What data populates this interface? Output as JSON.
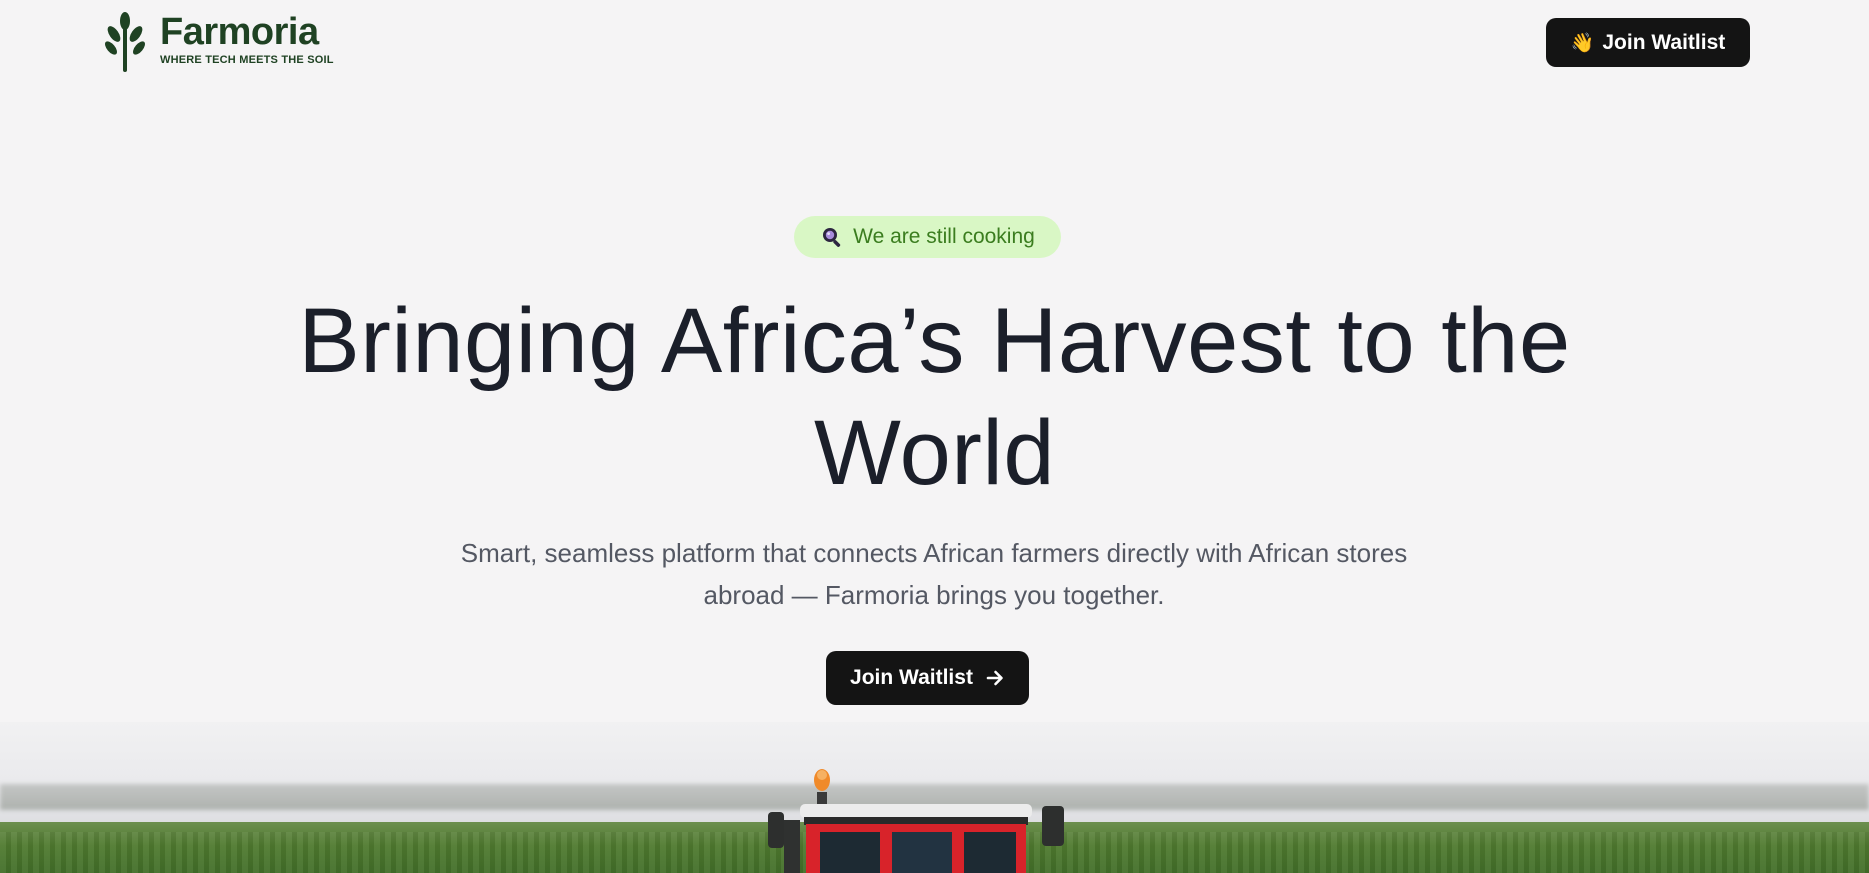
{
  "header": {
    "brand_name": "Farmoria",
    "tagline": "WHERE TECH MEETS THE SOIL",
    "cta_label": "Join Waitlist",
    "cta_icon": "waving-hand-icon"
  },
  "hero": {
    "badge_text": "We are still cooking",
    "badge_icon": "search-icon",
    "headline_line1": "Bringing Africa’s Harvest to the",
    "headline_line2": "World",
    "subtext_line1": "Smart, seamless platform that connects African farmers directly with African stores",
    "subtext_line2": "abroad — Farmoria brings you together.",
    "cta_label": "Join Waitlist",
    "cta_icon": "arrow-right-icon"
  },
  "colors": {
    "background": "#f5f4f5",
    "brand_green": "#1f4223",
    "badge_bg": "#d9f7c5",
    "badge_text": "#3b7d1f",
    "button_bg": "#141414",
    "headline": "#1b1f2a",
    "subtext": "#545863"
  }
}
